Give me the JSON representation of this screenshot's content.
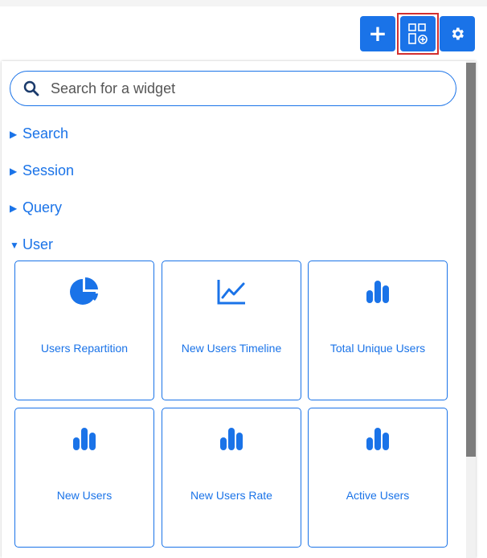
{
  "toolbar": {
    "add_label": "+",
    "widgets_icon": "widget-add-icon",
    "settings_icon": "gear-icon"
  },
  "search": {
    "placeholder": "Search for a widget",
    "icon": "search-icon"
  },
  "categories": [
    {
      "label": "Search",
      "expanded": false
    },
    {
      "label": "Session",
      "expanded": false
    },
    {
      "label": "Query",
      "expanded": false
    },
    {
      "label": "User",
      "expanded": true
    }
  ],
  "widgets": [
    {
      "label": "Users Repartition",
      "icon": "pie-chart-icon"
    },
    {
      "label": "New Users Timeline",
      "icon": "line-chart-icon"
    },
    {
      "label": "Total Unique Users",
      "icon": "bar-chart-icon"
    },
    {
      "label": "New Users",
      "icon": "bar-chart-icon"
    },
    {
      "label": "New Users Rate",
      "icon": "bar-chart-icon"
    },
    {
      "label": "Active Users",
      "icon": "bar-chart-icon"
    }
  ],
  "colors": {
    "accent": "#1a73e8",
    "highlight": "#d32f2f"
  }
}
